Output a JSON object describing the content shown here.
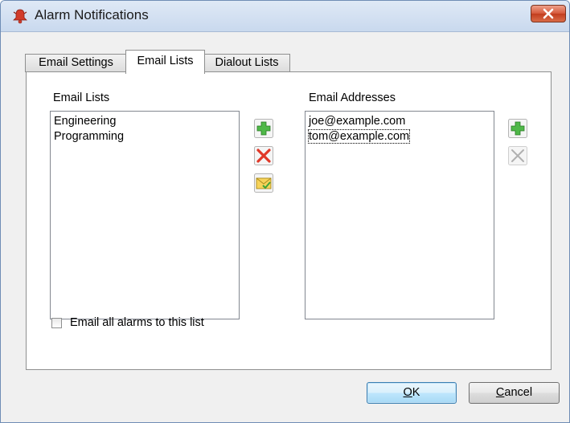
{
  "window": {
    "title": "Alarm Notifications"
  },
  "tabs": [
    {
      "label": "Email Settings"
    },
    {
      "label": "Email Lists"
    },
    {
      "label": "Dialout Lists"
    }
  ],
  "active_tab": "Email Lists",
  "email_lists": {
    "label": "Email Lists",
    "items": [
      "Engineering",
      "Programming"
    ]
  },
  "email_addresses": {
    "label": "Email Addresses",
    "items": [
      "joe@example.com",
      "tom@example.com"
    ],
    "focused_item": "tom@example.com"
  },
  "checkbox": {
    "label": "Email all alarms to this list",
    "checked": false
  },
  "buttons": {
    "ok_mnemonic": "O",
    "ok_rest": "K",
    "cancel_mnemonic": "C",
    "cancel_rest": "ancel"
  },
  "icons": {
    "app": "bell-icon",
    "add": "add-icon",
    "delete": "delete-icon",
    "email": "email-icon",
    "close": "close-icon"
  }
}
